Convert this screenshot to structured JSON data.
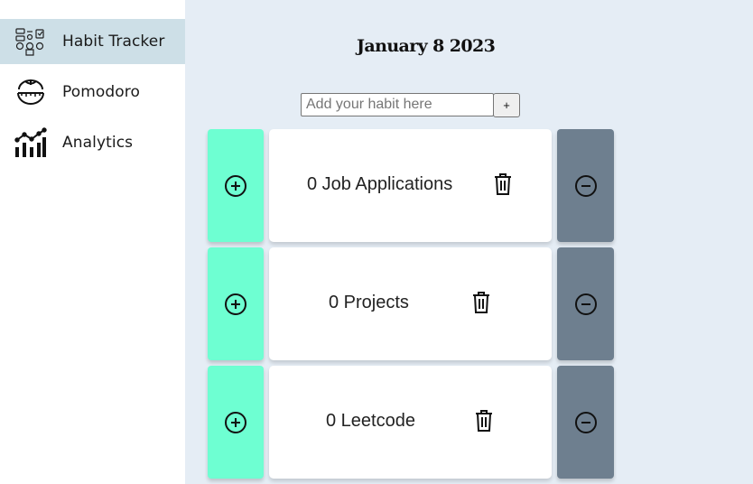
{
  "sidebar": {
    "items": [
      {
        "label": "Habit Tracker",
        "icon": "habit-tracker-icon",
        "active": true
      },
      {
        "label": "Pomodoro",
        "icon": "tomato-timer-icon",
        "active": false
      },
      {
        "label": "Analytics",
        "icon": "analytics-chart-icon",
        "active": false
      }
    ]
  },
  "main": {
    "date": "January 8 2023",
    "input_placeholder": "Add your habit here",
    "input_value": "",
    "add_label": "+",
    "habits": [
      {
        "text": "0 Job Applications"
      },
      {
        "text": "0 Projects"
      },
      {
        "text": "0 Leetcode"
      }
    ]
  },
  "colors": {
    "increment": "#6effd2",
    "decrement": "#6e7f8f",
    "active_nav": "#cddfe7",
    "background": "#e5edf5"
  }
}
